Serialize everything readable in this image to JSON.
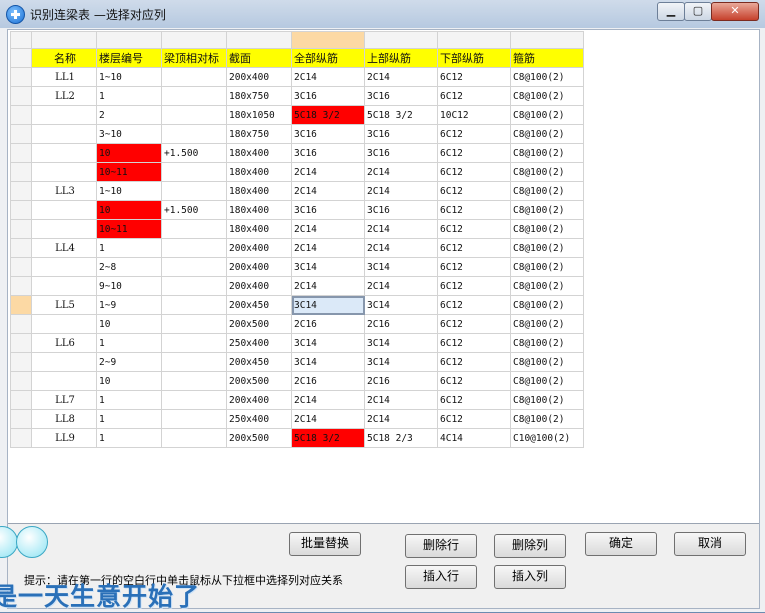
{
  "window": {
    "title": "识别连梁表 —选择对应列"
  },
  "controls": {
    "minimize": "▁",
    "maximize": "▢",
    "close": "✕"
  },
  "columns": [
    "名称",
    "楼层编号",
    "梁顶相对标",
    "截面",
    "全部纵筋",
    "上部纵筋",
    "下部纵筋",
    "箍筋"
  ],
  "rows": [
    [
      "LL1",
      "1~10",
      "",
      "200x400",
      "2C14",
      "2C14",
      "6C12",
      "C8@100(2)"
    ],
    [
      "LL2",
      "1",
      "",
      "180x750",
      "3C16",
      "3C16",
      "6C12",
      "C8@100(2)"
    ],
    [
      "",
      "2",
      "",
      "180x1050",
      "5C18 3/2",
      "5C18 3/2",
      "10C12",
      "C8@100(2)"
    ],
    [
      "",
      "3~10",
      "",
      "180x750",
      "3C16",
      "3C16",
      "6C12",
      "C8@100(2)"
    ],
    [
      "",
      "10",
      "+1.500",
      "180x400",
      "3C16",
      "3C16",
      "6C12",
      "C8@100(2)"
    ],
    [
      "",
      "10~11",
      "",
      "180x400",
      "2C14",
      "2C14",
      "6C12",
      "C8@100(2)"
    ],
    [
      "LL3",
      "1~10",
      "",
      "180x400",
      "2C14",
      "2C14",
      "6C12",
      "C8@100(2)"
    ],
    [
      "",
      "10",
      "+1.500",
      "180x400",
      "3C16",
      "3C16",
      "6C12",
      "C8@100(2)"
    ],
    [
      "",
      "10~11",
      "",
      "180x400",
      "2C14",
      "2C14",
      "6C12",
      "C8@100(2)"
    ],
    [
      "LL4",
      "1",
      "",
      "200x400",
      "2C14",
      "2C14",
      "6C12",
      "C8@100(2)"
    ],
    [
      "",
      "2~8",
      "",
      "200x400",
      "3C14",
      "3C14",
      "6C12",
      "C8@100(2)"
    ],
    [
      "",
      "9~10",
      "",
      "200x400",
      "2C14",
      "2C14",
      "6C12",
      "C8@100(2)"
    ],
    [
      "LL5",
      "1~9",
      "",
      "200x450",
      "3C14",
      "3C14",
      "6C12",
      "C8@100(2)"
    ],
    [
      "",
      "10",
      "",
      "200x500",
      "2C16",
      "2C16",
      "6C12",
      "C8@100(2)"
    ],
    [
      "LL6",
      "1",
      "",
      "250x400",
      "3C14",
      "3C14",
      "6C12",
      "C8@100(2)"
    ],
    [
      "",
      "2~9",
      "",
      "200x450",
      "3C14",
      "3C14",
      "6C12",
      "C8@100(2)"
    ],
    [
      "",
      "10",
      "",
      "200x500",
      "2C16",
      "2C16",
      "6C12",
      "C8@100(2)"
    ],
    [
      "LL7",
      "1",
      "",
      "200x400",
      "2C14",
      "2C14",
      "6C12",
      "C8@100(2)"
    ],
    [
      "LL8",
      "1",
      "",
      "250x400",
      "2C14",
      "2C14",
      "6C12",
      "C8@100(2)"
    ],
    [
      "LL9",
      "1",
      "",
      "200x500",
      "5C18 3/2",
      "5C18 2/3",
      "4C14",
      "C10@100(2)"
    ]
  ],
  "highlights": [
    {
      "row": 2,
      "col": 4
    },
    {
      "row": 4,
      "col": 1
    },
    {
      "row": 5,
      "col": 1
    },
    {
      "row": 7,
      "col": 1
    },
    {
      "row": 8,
      "col": 1
    },
    {
      "row": 19,
      "col": 4
    }
  ],
  "focus_cell": {
    "row": 12,
    "col": 4
  },
  "selected_column": 4,
  "current_row": 12,
  "colors": {
    "header_fill": "#ffff00",
    "error_fill": "#ff0000",
    "selection_header": "#fcd9a4"
  },
  "buttons": {
    "batch_replace": "批量替换",
    "delete_row": "删除行",
    "delete_column": "删除列",
    "insert_row": "插入行",
    "insert_column": "插入列",
    "ok": "确定",
    "cancel": "取消"
  },
  "hint": "提示：请在第一行的空白行中单击鼠标从下拉框中选择列对应关系",
  "overlay_text": "是一天生意开始了"
}
